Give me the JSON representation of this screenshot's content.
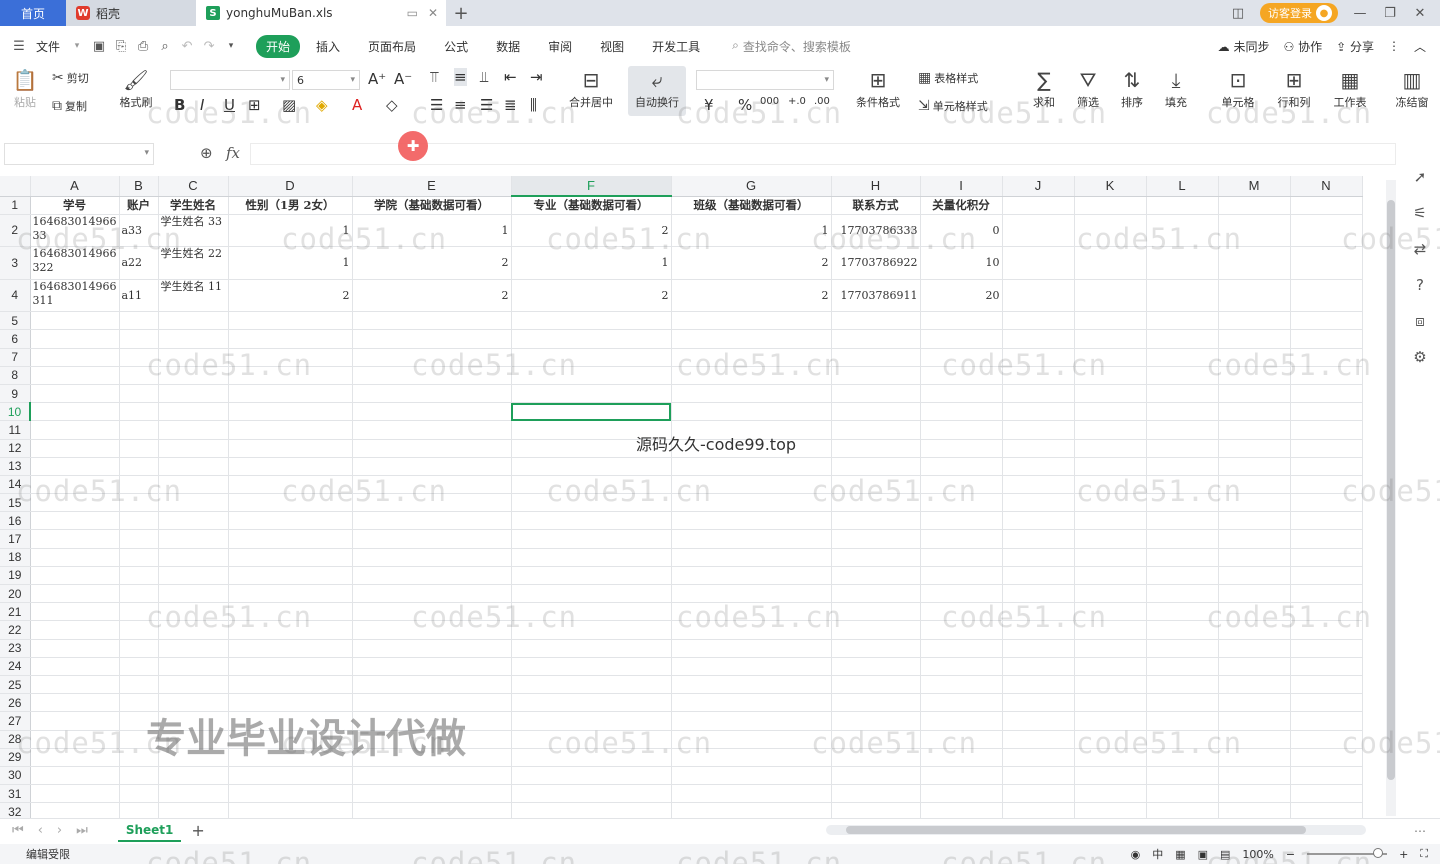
{
  "tabs": {
    "home": "首页",
    "doc": "稻壳",
    "file": "yonghuMuBan.xls",
    "guest_login": "访客登录"
  },
  "menu": {
    "file": "文件",
    "items": [
      "开始",
      "插入",
      "页面布局",
      "公式",
      "数据",
      "审阅",
      "视图",
      "开发工具"
    ],
    "search": "查找命令、搜索模板",
    "unsynced": "未同步",
    "collab": "协作",
    "share": "分享"
  },
  "ribbon": {
    "paste": "粘贴",
    "cut": "剪切",
    "copy": "复制",
    "format_painter": "格式刷",
    "font_size": "6",
    "merge_center": "合并居中",
    "auto_wrap": "自动换行",
    "cond_format": "条件格式",
    "table_style": "表格样式",
    "cell_style": "单元格样式",
    "sum": "求和",
    "filter": "筛选",
    "sort": "排序",
    "fill": "填充",
    "cell": "单元格",
    "row_col": "行和列",
    "worksheet": "工作表",
    "freeze": "冻结窗"
  },
  "formula": {
    "name_box": "",
    "fx": "fx",
    "value": ""
  },
  "sheet": {
    "columns": [
      "A",
      "B",
      "C",
      "D",
      "E",
      "F",
      "G",
      "H",
      "I",
      "J",
      "K",
      "L",
      "M",
      "N"
    ],
    "active_column": "F",
    "active_row": "10",
    "header_row": [
      "学号",
      "账户",
      "学生姓名",
      "性别（1男 2女）",
      "学院（基础数据可看）",
      "专业（基础数据可看）",
      "班级（基础数据可看）",
      "联系方式",
      "关量化积分"
    ],
    "rows": [
      [
        "164683014966 33",
        "a33",
        "学生姓名 33",
        "1",
        "1",
        "2",
        "1",
        "17703786333",
        "0"
      ],
      [
        "164683014966 322",
        "a22",
        "学生姓名 22",
        "1",
        "2",
        "1",
        "2",
        "17703786922",
        "10"
      ],
      [
        "164683014966 311",
        "a11",
        "学生姓名 11",
        "2",
        "2",
        "2",
        "2",
        "17703786911",
        "20"
      ]
    ],
    "row_numbers": [
      "1",
      "2",
      "3",
      "4",
      "5",
      "6",
      "7",
      "8",
      "9",
      "10",
      "11",
      "12",
      "13",
      "14",
      "15",
      "16",
      "17",
      "18",
      "19",
      "20",
      "21",
      "22",
      "23",
      "24",
      "25",
      "26",
      "27",
      "28",
      "29",
      "30",
      "31",
      "32"
    ],
    "sheet_tab": "Sheet1"
  },
  "watermarks": {
    "repeat": "code51.cn",
    "center": "源码久久-code99.top",
    "big": "专业毕业设计代做"
  },
  "status": {
    "left": "编辑受限",
    "zoom": "100%"
  },
  "colors": {
    "accent": "#1e9f5a",
    "home_tab": "#3b6fd8"
  }
}
